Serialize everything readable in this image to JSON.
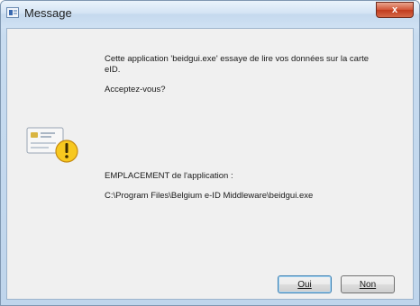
{
  "window": {
    "title": "Message",
    "close_glyph": "x"
  },
  "dialog": {
    "message_line1": "Cette application 'beidgui.exe' essaye de lire vos données sur la carte",
    "message_line2": "eID.",
    "question": "Acceptez-vous?",
    "location_label": "EMPLACEMENT de l'application :",
    "location_path": "C:\\Program Files\\Belgium e-ID Middleware\\beidgui.exe",
    "icon": "id-card-warning-icon"
  },
  "buttons": {
    "yes_label": "Oui",
    "no_label": "Non"
  },
  "colors": {
    "client_bg": "#f0f0f0",
    "titlebar": "#c8dcf0",
    "warning": "#f7c81f",
    "close_red": "#c13b1e"
  }
}
